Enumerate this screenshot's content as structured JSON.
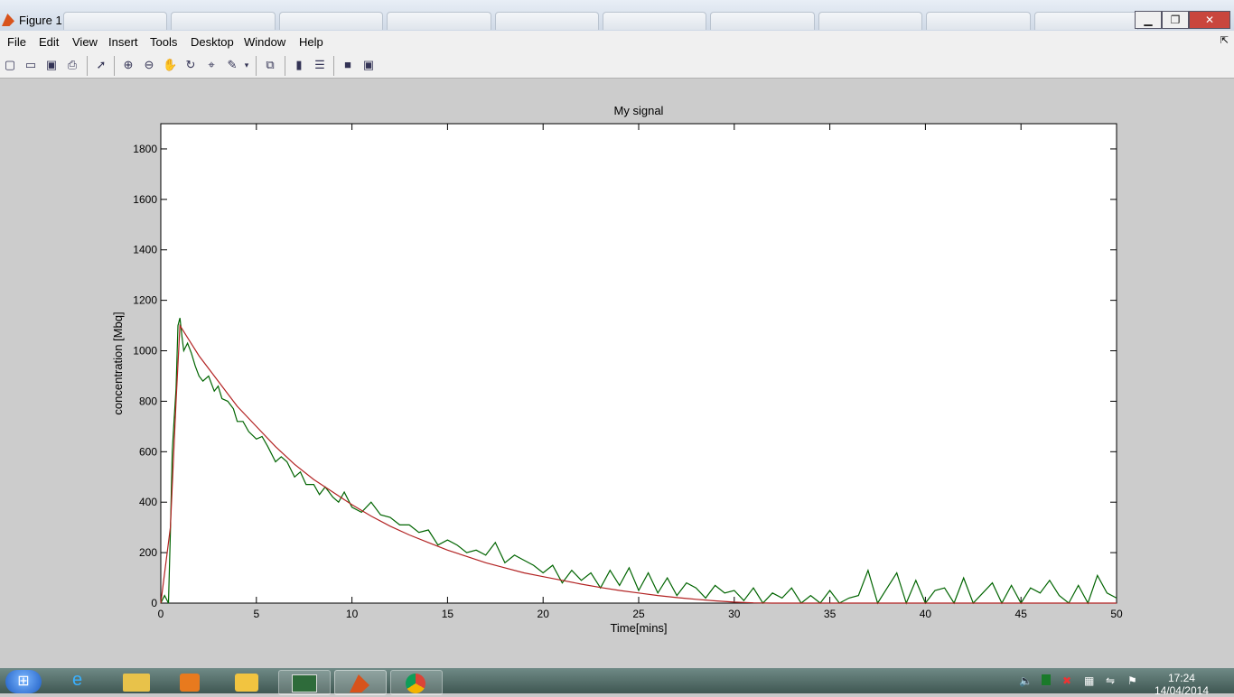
{
  "window": {
    "title": "Figure 1",
    "minimize": "▁",
    "maximize": "❐",
    "close": "✕"
  },
  "menu": [
    "File",
    "Edit",
    "View",
    "Insert",
    "Tools",
    "Desktop",
    "Window",
    "Help"
  ],
  "menu_pin": "⇱",
  "toolbar": {
    "icons": [
      "new-figure-icon",
      "open-file-icon",
      "save-icon",
      "print-icon",
      "pointer-icon",
      "zoom-in-icon",
      "zoom-out-icon",
      "pan-hand-icon",
      "rotate-3d-icon",
      "data-cursor-icon",
      "brush-icon",
      "link-plot-icon",
      "colorbar-icon",
      "legend-icon",
      "hide-plot-tools-icon",
      "show-plot-tools-icon"
    ]
  },
  "chart_data": {
    "type": "line",
    "title": "My signal",
    "xlabel": "Time[mins]",
    "ylabel": "concentration [Mbq]",
    "xlim": [
      0,
      50
    ],
    "ylim": [
      0,
      1900
    ],
    "xticks": [
      0,
      5,
      10,
      15,
      20,
      25,
      30,
      35,
      40,
      45,
      50
    ],
    "yticks": [
      0,
      200,
      400,
      600,
      800,
      1000,
      1200,
      1400,
      1600,
      1800
    ],
    "grid": false,
    "series": [
      {
        "color": "#006400",
        "style": "noisy",
        "x": [
          0,
          0.2,
          0.4,
          0.5,
          0.6,
          0.7,
          0.8,
          0.9,
          1.0,
          1.1,
          1.2,
          1.4,
          1.6,
          1.8,
          2.0,
          2.2,
          2.5,
          2.8,
          3.0,
          3.2,
          3.5,
          3.8,
          4.0,
          4.3,
          4.6,
          5.0,
          5.3,
          5.6,
          6.0,
          6.3,
          6.6,
          7.0,
          7.3,
          7.6,
          8.0,
          8.3,
          8.6,
          9.0,
          9.3,
          9.6,
          10.0,
          10.5,
          11.0,
          11.5,
          12.0,
          12.5,
          13.0,
          13.5,
          14.0,
          14.5,
          15.0,
          15.5,
          16.0,
          16.5,
          17.0,
          17.5,
          18.0,
          18.5,
          19.0,
          19.5,
          20.0,
          20.5,
          21.0,
          21.5,
          22.0,
          22.5,
          23.0,
          23.5,
          24.0,
          24.5,
          25.0,
          25.5,
          26.0,
          26.5,
          27.0,
          27.5,
          28.0,
          28.5,
          29.0,
          29.5,
          30.0,
          30.5,
          31.0,
          31.5,
          32.0,
          32.5,
          33.0,
          33.5,
          34.0,
          34.5,
          35.0,
          35.5,
          36.0,
          36.5,
          37.0,
          37.5,
          38.0,
          38.5,
          39.0,
          39.5,
          40.0,
          40.5,
          41.0,
          41.5,
          42.0,
          42.5,
          43.0,
          43.5,
          44.0,
          44.5,
          45.0,
          45.5,
          46.0,
          46.5,
          47.0,
          47.5,
          48.0,
          48.5,
          49.0,
          49.5,
          50.0
        ],
        "y": [
          0,
          30,
          0,
          280,
          600,
          730,
          850,
          1100,
          1130,
          1060,
          1000,
          1030,
          990,
          940,
          900,
          880,
          900,
          840,
          860,
          810,
          800,
          770,
          720,
          720,
          680,
          650,
          660,
          620,
          560,
          580,
          560,
          500,
          520,
          470,
          470,
          430,
          460,
          420,
          400,
          440,
          380,
          360,
          400,
          350,
          340,
          310,
          310,
          280,
          290,
          230,
          250,
          230,
          200,
          210,
          190,
          240,
          160,
          190,
          170,
          150,
          120,
          150,
          80,
          130,
          90,
          120,
          60,
          130,
          70,
          140,
          50,
          120,
          40,
          100,
          30,
          80,
          60,
          20,
          70,
          40,
          50,
          10,
          60,
          0,
          40,
          20,
          60,
          0,
          30,
          0,
          50,
          0,
          20,
          30,
          130,
          0,
          60,
          120,
          0,
          90,
          0,
          50,
          60,
          0,
          100,
          0,
          40,
          80,
          0,
          70,
          0,
          60,
          40,
          90,
          30,
          0,
          70,
          0,
          110,
          40,
          20
        ]
      },
      {
        "color": "#b22222",
        "style": "smooth-fit",
        "x": [
          0,
          0.5,
          0.8,
          1.0,
          1.5,
          2,
          3,
          4,
          5,
          6,
          7,
          8,
          9,
          10,
          11,
          12,
          13,
          14,
          15,
          16,
          17,
          18,
          19,
          20,
          21,
          22,
          23,
          24,
          25,
          26,
          27,
          28,
          29,
          30,
          31,
          32,
          33,
          34,
          35,
          36,
          37,
          38,
          39,
          40,
          41,
          42,
          43,
          44,
          45,
          46,
          47,
          48,
          49,
          50
        ],
        "y": [
          0,
          300,
          800,
          1100,
          1040,
          980,
          880,
          780,
          700,
          620,
          550,
          490,
          440,
          390,
          345,
          305,
          270,
          240,
          210,
          185,
          160,
          140,
          120,
          105,
          90,
          75,
          62,
          50,
          40,
          30,
          22,
          15,
          9,
          4,
          1,
          0,
          0,
          0,
          0,
          0,
          0,
          0,
          0,
          0,
          0,
          0,
          0,
          0,
          0,
          0,
          0,
          0,
          0,
          0
        ]
      }
    ]
  },
  "taskbar": {
    "start_icon": "windows-start-icon",
    "apps": [
      "internet-explorer-icon",
      "file-explorer-icon",
      "media-player-icon",
      "outlook-icon",
      "task-manager-icon",
      "matlab-icon",
      "chrome-icon"
    ],
    "clock_time": "17:24",
    "clock_date": "14/04/2014"
  }
}
